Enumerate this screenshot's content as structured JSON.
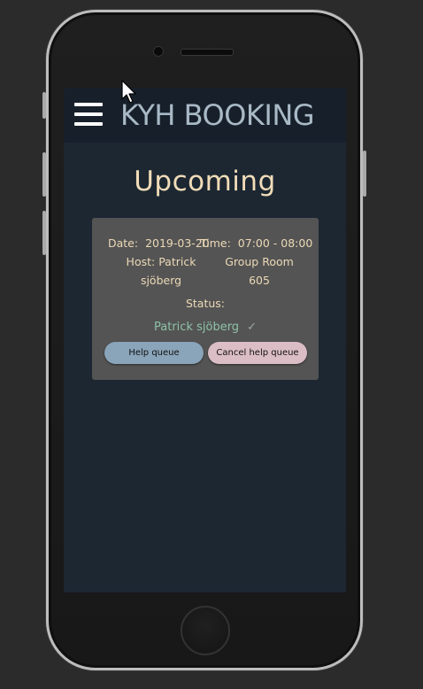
{
  "header": {
    "brand": "KYH BOOKING"
  },
  "page": {
    "title": "Upcoming"
  },
  "booking": {
    "date_label": "Date:",
    "date": "2019-03-20",
    "time_label": "Time:",
    "time": "07:00 - 08:00",
    "host_line1": "Host: Patrick",
    "host_line2": "sjöberg",
    "room_line1": "Group Room",
    "room_line2": "605",
    "status_label": "Status:",
    "queue_name": "Patrick sjöberg",
    "buttons": {
      "help": "Help queue",
      "cancel": "Cancel help queue"
    }
  },
  "icons": [
    "hamburger-menu-icon",
    "check-icon",
    "mouse-cursor-icon"
  ]
}
